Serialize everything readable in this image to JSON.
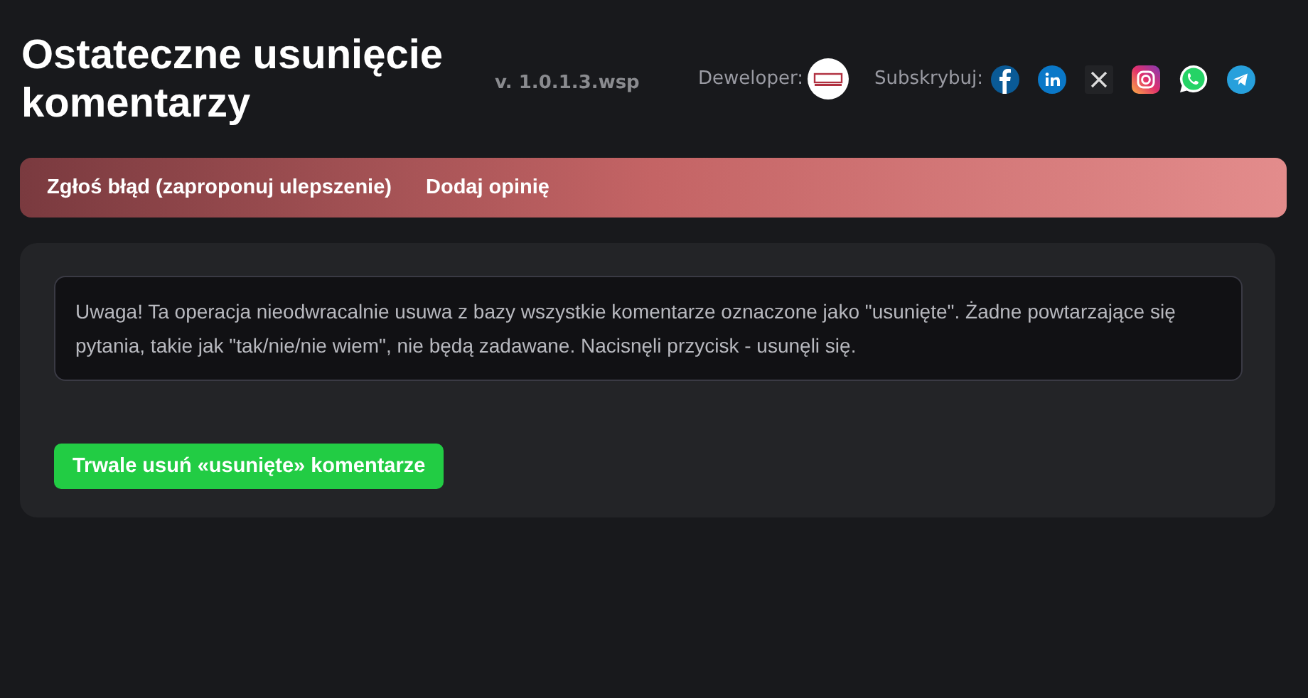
{
  "header": {
    "title": "Ostateczne usunięcie komentarzy",
    "version": "v. 1.0.1.3.wsp",
    "developer_label": "Deweloper:",
    "subscribe_label": "Subskrybuj:"
  },
  "nav": {
    "links": [
      "Zgłoś błąd (zaproponuj ulepszenie)",
      "Dodaj opinię"
    ]
  },
  "notice": {
    "text": "Uwaga! Ta operacja nieodwracalnie usuwa z bazy wszystkie komentarze oznaczone jako \"usunięte\". Żadne powtarzające się pytania, takie jak \"tak/nie/nie wiem\", nie będą zadawane. Nacisnęli przycisk - usunęli się."
  },
  "action_button": {
    "label": "Trwale usuń «usunięte» komentarze"
  }
}
